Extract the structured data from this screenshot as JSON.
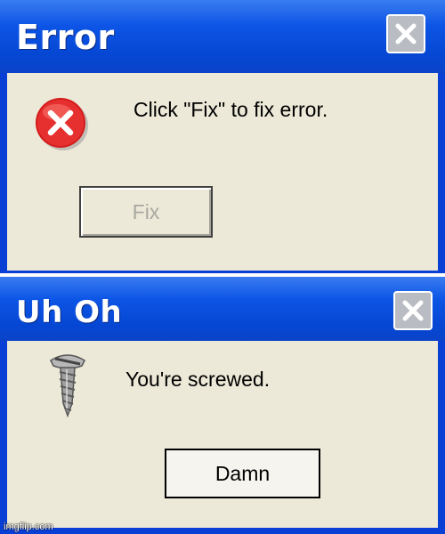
{
  "dialogs": [
    {
      "title": "Error",
      "message": "Click \"Fix\" to fix error.",
      "button_label": "Fix",
      "button_state": "disabled",
      "icon": "error-x-icon"
    },
    {
      "title": "Uh Oh",
      "message": "You're screwed.",
      "button_label": "Damn",
      "icon": "screw-icon"
    }
  ],
  "watermark": "imgflip.com",
  "colors": {
    "titlebar": "#0547d3",
    "body": "#ece9d8",
    "error_red": "#e02020",
    "close_button": "#b9bcc2"
  }
}
